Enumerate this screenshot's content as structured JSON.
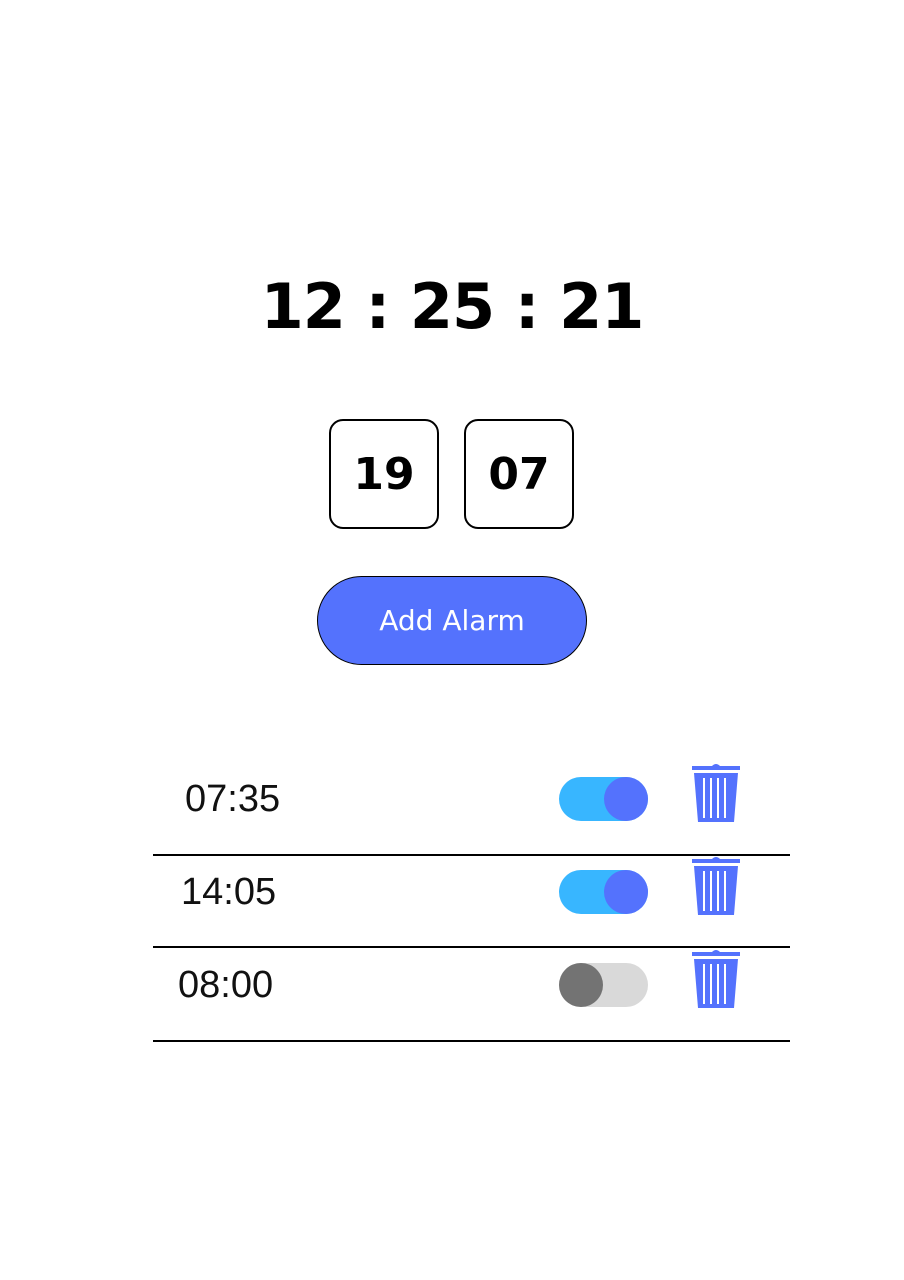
{
  "clock": {
    "current_time": "12 : 25 : 21"
  },
  "time_picker": {
    "hour": "19",
    "minute": "07"
  },
  "add_button": {
    "label": "Add Alarm"
  },
  "colors": {
    "accent": "#5472fd",
    "toggle_on_track": "#38b6ff",
    "toggle_off_track": "#d9d9d9",
    "toggle_off_knob": "#737373"
  },
  "alarms": [
    {
      "time": "07:35",
      "enabled": true,
      "delete_icon": "trash-icon"
    },
    {
      "time": "14:05",
      "enabled": true,
      "delete_icon": "trash-icon"
    },
    {
      "time": "08:00",
      "enabled": false,
      "delete_icon": "trash-icon"
    }
  ]
}
